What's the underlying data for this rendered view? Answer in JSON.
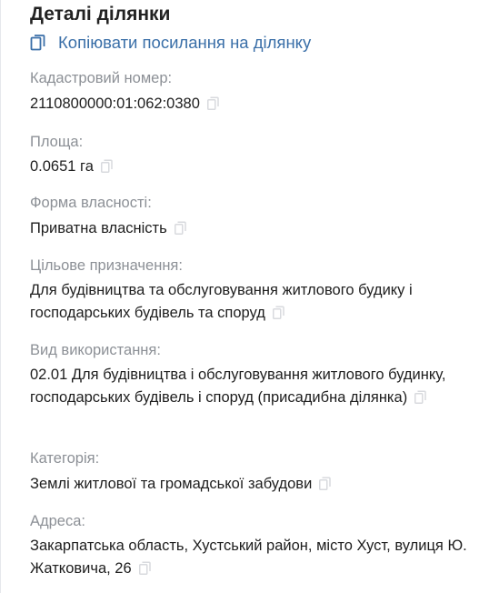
{
  "header": {
    "title": "Деталі ділянки",
    "copy_link_label": "Копіювати посилання на ділянку"
  },
  "fields": {
    "cadastral": {
      "label": "Кадастровий номер:",
      "value": "2110800000:01:062:0380"
    },
    "area": {
      "label": "Площа:",
      "value": "0.0651 га"
    },
    "ownership": {
      "label": "Форма власності:",
      "value": "Приватна власність"
    },
    "purpose": {
      "label": "Цільове призначення:",
      "value": "Для будівництва та обслуговування житлового будику і господарських будівель та споруд"
    },
    "usage": {
      "label": "Вид використання:",
      "value": "02.01 Для будівництва і обслуговування житлового будинку, господарських будівель і споруд (присадибна ділянка)"
    },
    "category": {
      "label": "Категорія:",
      "value": "Землі житлової та громадської забудови"
    },
    "address": {
      "label": "Адреса:",
      "value": "Закарпатська область, Хустський район, місто Хуст, вулиця Ю. Жатковича, 26"
    }
  },
  "colors": {
    "accent": "#3a6fa8",
    "label": "#8c9096",
    "copy_icon_faint": "#d8dade"
  },
  "icons": {
    "copy_link": "copy-icon",
    "copy_value": "copy-icon"
  }
}
